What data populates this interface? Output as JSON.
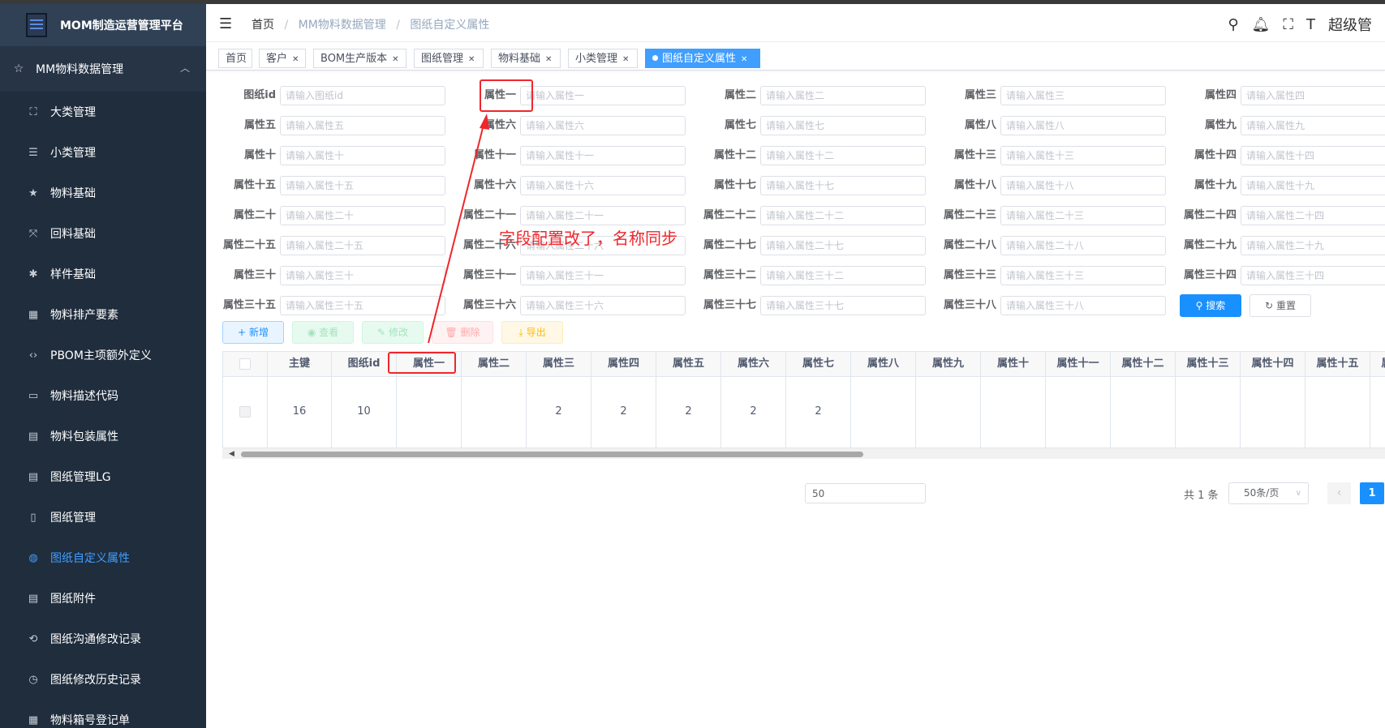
{
  "app": {
    "title": "MOM制造运营管理平台"
  },
  "sidebar": {
    "group": {
      "label": "MM物料数据管理",
      "icon": "star-outline-icon"
    },
    "items": [
      {
        "label": "大类管理",
        "icon": "tree-structure-icon"
      },
      {
        "label": "小类管理",
        "icon": "list-icon"
      },
      {
        "label": "物料基础",
        "icon": "star-icon"
      },
      {
        "label": "回料基础",
        "icon": "compress-icon"
      },
      {
        "label": "样件基础",
        "icon": "bug-icon"
      },
      {
        "label": "物料排产要素",
        "icon": "calendar-icon"
      },
      {
        "label": "PBOM主项额外定义",
        "icon": "code-icon"
      },
      {
        "label": "物料描述代码",
        "icon": "monitor-icon"
      },
      {
        "label": "物料包装属性",
        "icon": "clipboard-icon"
      },
      {
        "label": "图纸管理LG",
        "icon": "document-icon"
      },
      {
        "label": "图纸管理",
        "icon": "file-icon"
      },
      {
        "label": "图纸自定义属性",
        "icon": "palette-icon",
        "active": true
      },
      {
        "label": "图纸附件",
        "icon": "attachment-document-icon"
      },
      {
        "label": "图纸沟通修改记录",
        "icon": "history-edit-icon"
      },
      {
        "label": "图纸修改历史记录",
        "icon": "clock-icon"
      },
      {
        "label": "物料箱号登记单",
        "icon": "grid-icon"
      }
    ]
  },
  "header": {
    "breadcrumb": [
      "首页",
      "MM物料数据管理",
      "图纸自定义属性"
    ],
    "user": "超级管"
  },
  "tags": [
    {
      "label": "首页",
      "closable": false
    },
    {
      "label": "客户",
      "closable": true
    },
    {
      "label": "BOM生产版本",
      "closable": true
    },
    {
      "label": "图纸管理",
      "closable": true
    },
    {
      "label": "物料基础",
      "closable": true
    },
    {
      "label": "小类管理",
      "closable": true
    },
    {
      "label": "图纸自定义属性",
      "closable": true,
      "active": true
    }
  ],
  "form": {
    "fields": [
      {
        "label": "图纸id",
        "placeholder": "请输入图纸id"
      },
      {
        "label": "属性一",
        "placeholder": "请输入属性一"
      },
      {
        "label": "属性二",
        "placeholder": "请输入属性二"
      },
      {
        "label": "属性三",
        "placeholder": "请输入属性三"
      },
      {
        "label": "属性四",
        "placeholder": "请输入属性四"
      },
      {
        "label": "属性五",
        "placeholder": "请输入属性五"
      },
      {
        "label": "属性六",
        "placeholder": "请输入属性六"
      },
      {
        "label": "属性七",
        "placeholder": "请输入属性七"
      },
      {
        "label": "属性八",
        "placeholder": "请输入属性八"
      },
      {
        "label": "属性九",
        "placeholder": "请输入属性九"
      },
      {
        "label": "属性十",
        "placeholder": "请输入属性十"
      },
      {
        "label": "属性十一",
        "placeholder": "请输入属性十一"
      },
      {
        "label": "属性十二",
        "placeholder": "请输入属性十二"
      },
      {
        "label": "属性十三",
        "placeholder": "请输入属性十三"
      },
      {
        "label": "属性十四",
        "placeholder": "请输入属性十四"
      },
      {
        "label": "属性十五",
        "placeholder": "请输入属性十五"
      },
      {
        "label": "属性十六",
        "placeholder": "请输入属性十六"
      },
      {
        "label": "属性十七",
        "placeholder": "请输入属性十七"
      },
      {
        "label": "属性十八",
        "placeholder": "请输入属性十八"
      },
      {
        "label": "属性十九",
        "placeholder": "请输入属性十九"
      },
      {
        "label": "属性二十",
        "placeholder": "请输入属性二十"
      },
      {
        "label": "属性二十一",
        "placeholder": "请输入属性二十一"
      },
      {
        "label": "属性二十二",
        "placeholder": "请输入属性二十二"
      },
      {
        "label": "属性二十三",
        "placeholder": "请输入属性二十三"
      },
      {
        "label": "属性二十四",
        "placeholder": "请输入属性二十四"
      },
      {
        "label": "属性二十五",
        "placeholder": "请输入属性二十五"
      },
      {
        "label": "属性二十六",
        "placeholder": "请输入属性二十六"
      },
      {
        "label": "属性二十七",
        "placeholder": "请输入属性二十七"
      },
      {
        "label": "属性二十八",
        "placeholder": "请输入属性二十八"
      },
      {
        "label": "属性二十九",
        "placeholder": "请输入属性二十九"
      },
      {
        "label": "属性三十",
        "placeholder": "请输入属性三十"
      },
      {
        "label": "属性三十一",
        "placeholder": "请输入属性三十一"
      },
      {
        "label": "属性三十二",
        "placeholder": "请输入属性三十二"
      },
      {
        "label": "属性三十三",
        "placeholder": "请输入属性三十三"
      },
      {
        "label": "属性三十四",
        "placeholder": "请输入属性三十四"
      },
      {
        "label": "属性三十五",
        "placeholder": "请输入属性三十五"
      },
      {
        "label": "属性三十六",
        "placeholder": "请输入属性三十六"
      },
      {
        "label": "属性三十七",
        "placeholder": "请输入属性三十七"
      },
      {
        "label": "属性三十八",
        "placeholder": "请输入属性三十八"
      }
    ],
    "search_label": "搜索",
    "reset_label": "重置"
  },
  "toolbar": {
    "add_label": "新增",
    "view_label": "查看",
    "edit_label": "修改",
    "delete_label": "删除",
    "export_label": "导出"
  },
  "table": {
    "columns": [
      "主键",
      "图纸id",
      "属性一",
      "属性二",
      "属性三",
      "属性四",
      "属性五",
      "属性六",
      "属性七",
      "属性八",
      "属性九",
      "属性十",
      "属性十一",
      "属性十二",
      "属性十三",
      "属性十四",
      "属性十五",
      "属性十六"
    ],
    "rows": [
      [
        "16",
        "10",
        "",
        "",
        "2",
        "2",
        "2",
        "2",
        "2",
        "",
        "",
        "",
        "",
        "",
        "",
        "",
        "",
        ""
      ]
    ]
  },
  "pagination": {
    "input_value": "50",
    "total": "共 1 条",
    "page_size": "50条/页",
    "current_page": "1"
  },
  "annotation": {
    "text": "字段配置改了，名称同步",
    "color": "#f0262b"
  }
}
